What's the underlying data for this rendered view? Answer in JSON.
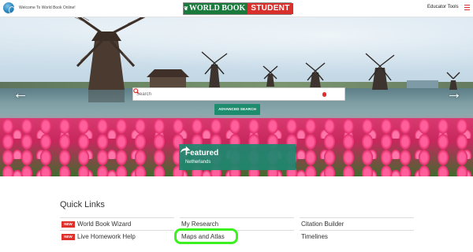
{
  "header": {
    "welcome": "Welcome To World Book Online!",
    "logo_world_book": "WORLD BOOK",
    "logo_student": "STUDENT",
    "educator_tools": "Educator Tools"
  },
  "hero": {
    "search_placeholder": "Search",
    "advanced_search": "ADVANCED SEARCH",
    "prev_arrow": "←",
    "next_arrow": "→",
    "featured": {
      "title": "Featured",
      "subtitle": "Netherlands"
    }
  },
  "quick_links": {
    "title": "Quick Links",
    "badge": "NEW",
    "col1": [
      {
        "label": "World Book Wizard",
        "new": true
      },
      {
        "label": "Live Homework Help",
        "new": true
      }
    ],
    "col2": [
      {
        "label": "My Research",
        "new": false
      },
      {
        "label": "Maps and Atlas",
        "new": false
      }
    ],
    "col3": [
      {
        "label": "Citation Builder",
        "new": false
      },
      {
        "label": "Timelines",
        "new": false
      }
    ]
  },
  "colors": {
    "brand_red": "#e0302c",
    "brand_green": "#1a7a3c",
    "featured_teal": "#1c886f",
    "highlight_green": "#3df121"
  }
}
